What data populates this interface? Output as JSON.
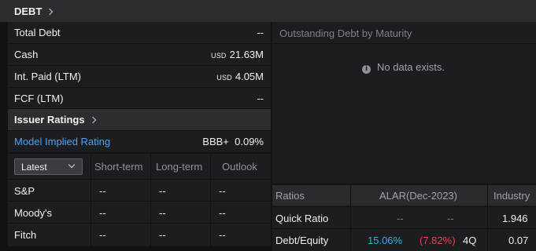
{
  "debt": {
    "title": "DEBT",
    "rows": [
      {
        "label": "Total Debt",
        "currency": "",
        "value": "--"
      },
      {
        "label": "Cash",
        "currency": "USD",
        "value": "21.63M"
      },
      {
        "label": "Int. Paid (LTM)",
        "currency": "USD",
        "value": "4.05M"
      },
      {
        "label": "FCF (LTM)",
        "currency": "",
        "value": "--"
      }
    ]
  },
  "issuer": {
    "title": "Issuer Ratings",
    "model_label": "Model Implied Rating",
    "model_value": "BBB+",
    "model_pct": "0.09%",
    "period_selected": "Latest",
    "columns": [
      "Short-term",
      "Long-term",
      "Outlook"
    ],
    "rows": [
      {
        "agency": "S&P",
        "short": "--",
        "long": "--",
        "outlook": "--"
      },
      {
        "agency": "Moody's",
        "short": "--",
        "long": "--",
        "outlook": "--"
      },
      {
        "agency": "Fitch",
        "short": "--",
        "long": "--",
        "outlook": "--"
      }
    ]
  },
  "maturity": {
    "title": "Outstanding Debt by Maturity",
    "empty_message": "No data exists.",
    "icon": "info-icon"
  },
  "ratios": {
    "col_ratios": "Ratios",
    "col_company": "ALAR(Dec-2023)",
    "col_industry": "Industry",
    "rows": [
      {
        "label": "Quick Ratio",
        "value": "--",
        "change": "--",
        "period": "",
        "industry": "1.946"
      },
      {
        "label": "Debt/Equity",
        "value": "15.06%",
        "change": "(7.82%)",
        "period": "4Q",
        "industry": "0.07"
      }
    ]
  },
  "colors": {
    "link": "#4aa3f0",
    "positive": "#2fb344",
    "value": "#2db5e6",
    "negative": "#e8434c"
  }
}
